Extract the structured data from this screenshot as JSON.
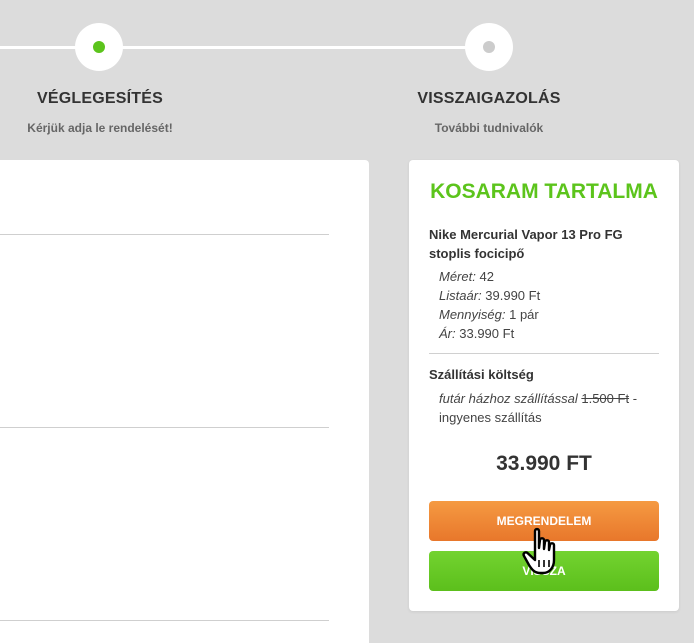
{
  "steps": [
    {
      "title": "VÉGLEGESÍTÉS",
      "subtitle": "Kérjük adja le rendelését!",
      "state": "active"
    },
    {
      "title": "VISSZAIGAZOLÁS",
      "subtitle": "További tudnivalók",
      "state": "inactive"
    }
  ],
  "colors": {
    "accent_green": "#5cc41c",
    "order_orange": "#f0882f"
  },
  "cart": {
    "title": "KOSARAM TARTALMA",
    "product": {
      "name": "Nike Mercurial Vapor 13 Pro FG stoplis focicipő",
      "attributes": [
        {
          "label": "Méret:",
          "value": "42"
        },
        {
          "label": "Listaár:",
          "value": "39.990 Ft"
        },
        {
          "label": "Mennyiség:",
          "value": "1 pár"
        },
        {
          "label": "Ár:",
          "value": "33.990 Ft"
        }
      ]
    },
    "shipping": {
      "title": "Szállítási költség",
      "method": "futár házhoz szállítással",
      "old_price": "1.500 Ft",
      "separator": "-",
      "note": "ingyenes szállítás"
    },
    "total": "33.990 FT",
    "order_button": "MEGRENDELEM",
    "back_button": "VISSZA"
  },
  "cursor": "hand-pointer-icon"
}
